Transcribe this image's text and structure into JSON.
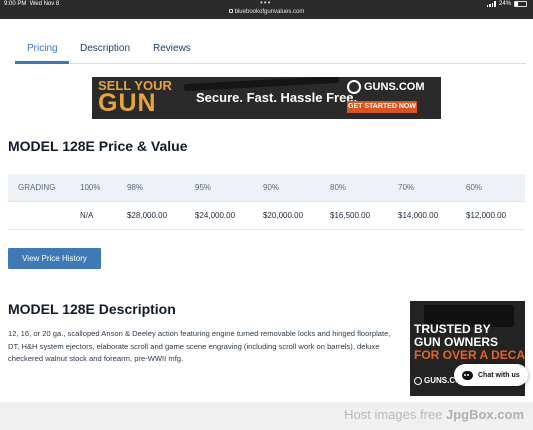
{
  "status_bar": {
    "time": "9:00 PM",
    "date": "Wed Nov 8",
    "url": "bluebookofgunvalues.com",
    "battery": "24%"
  },
  "tabs": [
    {
      "label": "Pricing",
      "active": true
    },
    {
      "label": "Description",
      "active": false
    },
    {
      "label": "Reviews",
      "active": false
    }
  ],
  "ad_banner": {
    "line1": "SELL YOUR",
    "line2": "GUN",
    "tagline": "Secure. Fast. Hassle Free.",
    "brand": "GUNS.COM",
    "cta": "GET STARTED NOW"
  },
  "price_section": {
    "title": "MODEL 128E Price & Value",
    "headers": [
      "GRADING",
      "100%",
      "98%",
      "95%",
      "90%",
      "80%",
      "70%",
      "60%"
    ],
    "values": [
      "",
      "N/A",
      "$28,000.00",
      "$24,000.00",
      "$20,000.00",
      "$16,500.00",
      "$14,000.00",
      "$12,000.00"
    ],
    "button_label": "View Price History"
  },
  "description_section": {
    "title": "MODEL 128E Description",
    "text": "12, 16, or 20 ga., scalloped Anson & Deeley action featuring engine turned removable locks and hinged floorplate, DT, H&H system ejectors, elaborate scroll and game scene engraving (including scroll work on barrels), deluxe checkered walnut stock and forearm, pre-WWII mfg."
  },
  "side_ad": {
    "line1": "TRUSTED BY",
    "line2": "GUN OWNERS",
    "line3": "FOR OVER A DECADE",
    "brand": "GUNS.COM"
  },
  "chat": {
    "label": "Chat with us"
  },
  "watermark": {
    "text_a": "Host images free ",
    "text_b": "JpgBox.com"
  },
  "colors": {
    "accent": "#3a78b6",
    "button": "#3f79b8",
    "ad_orange": "#e8a339",
    "cta_orange": "#d9541e"
  }
}
